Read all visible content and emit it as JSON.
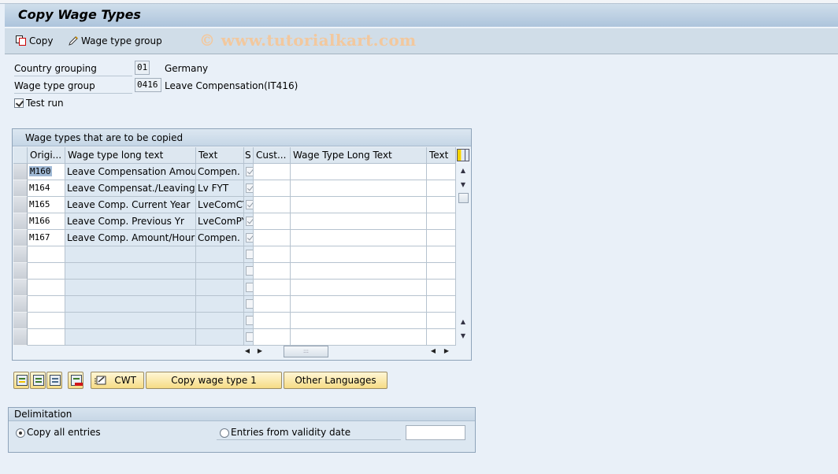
{
  "window": {
    "title": "Copy Wage Types"
  },
  "toolbar": {
    "copy_label": "Copy",
    "wage_type_group_label": "Wage type group",
    "watermark": "© www.tutorialkart.com"
  },
  "form": {
    "country_grouping": {
      "label": "Country grouping",
      "value": "01",
      "description": "Germany"
    },
    "wage_type_group": {
      "label": "Wage type group",
      "value": "0416",
      "description": "Leave Compensation(IT416)"
    },
    "test_run": {
      "label": "Test run",
      "checked": true
    }
  },
  "table": {
    "title": "Wage types that are to be copied",
    "columns": [
      "Origi...",
      "Wage type long text",
      "Text",
      "S",
      "Cust...",
      "Wage Type Long Text",
      "Text"
    ],
    "rows": [
      {
        "orig": "M160",
        "long_text": "Leave Compensation Amount",
        "text": "Compen.",
        "s": true,
        "cust": "",
        "new_long_text": "",
        "new_text": ""
      },
      {
        "orig": "M164",
        "long_text": "Leave Compensat./Leaving",
        "text": "Lv FYT",
        "s": true,
        "cust": "",
        "new_long_text": "",
        "new_text": ""
      },
      {
        "orig": "M165",
        "long_text": "Leave Comp. Current Year",
        "text": "LveComCY",
        "s": true,
        "cust": "",
        "new_long_text": "",
        "new_text": ""
      },
      {
        "orig": "M166",
        "long_text": "Leave Comp. Previous Yr",
        "text": "LveComPY",
        "s": true,
        "cust": "",
        "new_long_text": "",
        "new_text": ""
      },
      {
        "orig": "M167",
        "long_text": "Leave Comp. Amount/Hour",
        "text": "Compen.",
        "s": true,
        "cust": "",
        "new_long_text": "",
        "new_text": ""
      }
    ],
    "empty_rows": 6,
    "hscroll_thumb_label": ":::"
  },
  "buttons": {
    "cwt": "CWT",
    "copy_wage_type": "Copy wage type 1",
    "other_languages": "Other Languages"
  },
  "delimitation": {
    "title": "Delimitation",
    "option_all": "Copy all entries",
    "option_from_date": "Entries from validity date",
    "selected": "all",
    "date_value": ""
  }
}
